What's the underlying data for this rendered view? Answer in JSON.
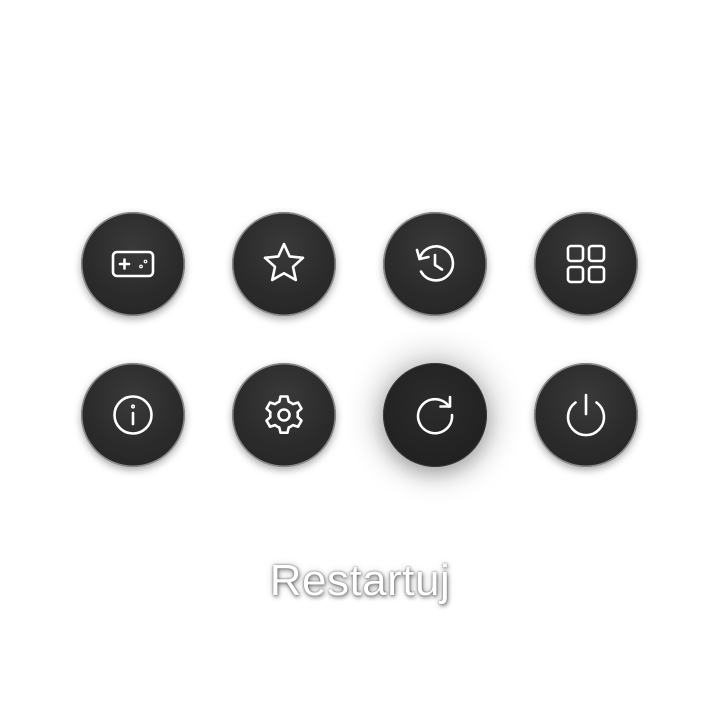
{
  "menu": {
    "items": [
      {
        "icon": "gamepad-icon"
      },
      {
        "icon": "star-icon"
      },
      {
        "icon": "history-icon"
      },
      {
        "icon": "apps-grid-icon"
      },
      {
        "icon": "info-icon"
      },
      {
        "icon": "gear-icon"
      },
      {
        "icon": "restart-icon",
        "selected": true
      },
      {
        "icon": "power-icon"
      }
    ],
    "selected_label": "Restartuj"
  },
  "colors": {
    "background": "#ffffff",
    "button": "#2b2b2b",
    "button_border": "#8a8a8a",
    "icon": "#ffffff",
    "caption": "#ffffff"
  }
}
